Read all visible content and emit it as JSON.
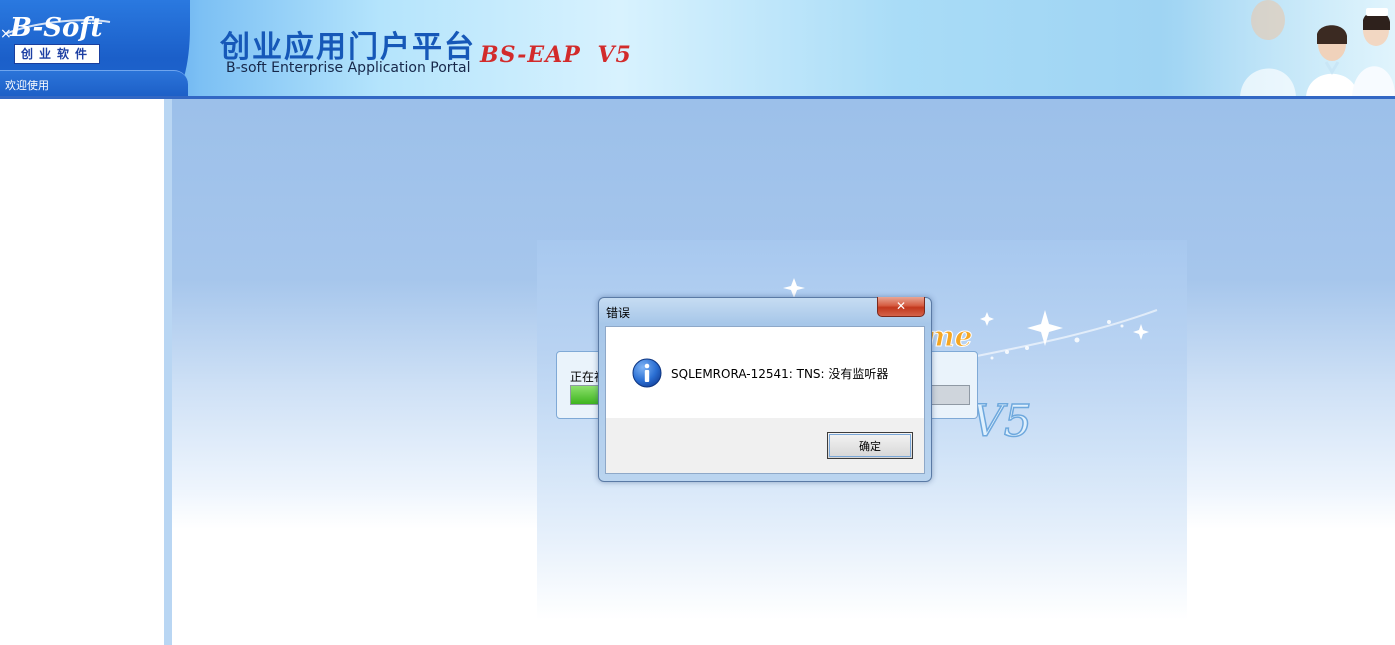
{
  "header": {
    "logo_text": "B-Soft",
    "logo_cn": "创业软件",
    "title_cn": "创业应用门户平台",
    "title_en": "B-soft Enterprise Application Portal",
    "brand": "BS-EAP",
    "brand_version": "V5",
    "welcome": "欢迎使用"
  },
  "splash": {
    "welcome_fragment": "me",
    "version": "V5",
    "progress_label": "正在初",
    "progress_fraction": 0.12
  },
  "dialog": {
    "title": "错误",
    "close_glyph": "✕",
    "icon": "info-icon",
    "message": "SQLEMRORA-12541: TNS: 没有监听器",
    "ok_label": "确定"
  },
  "colors": {
    "header_blue": "#1f6fd8",
    "brand_red": "#d22b2b",
    "close_red": "#c2371d",
    "info_blue": "#1c5fc7"
  }
}
